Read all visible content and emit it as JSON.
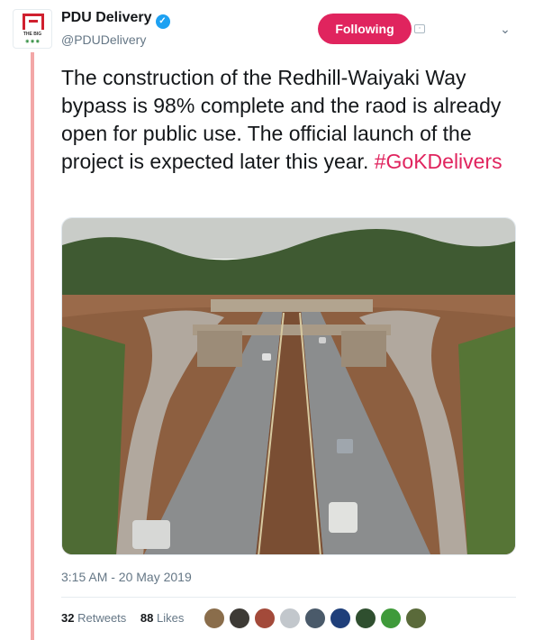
{
  "author": {
    "name": "PDU Delivery",
    "handle": "@PDUDelivery",
    "avatar_text": "THE BIG",
    "avatar_sub": "◉ ◉ ◉"
  },
  "follow_label": "Following",
  "tweet": {
    "text": "The construction of the Redhill-Waiyaki Way bypass is 98% complete and the raod is already open for public use. The official launch of the project is expected later this year.",
    "hashtag": "#GoKDelivers"
  },
  "timestamp": "3:15 AM - 20 May 2019",
  "stats": {
    "retweets_count": "32",
    "retweets_label": "Retweets",
    "likes_count": "88",
    "likes_label": "Likes"
  },
  "likers": [
    {
      "color": "#8a6d4b"
    },
    {
      "color": "#3d3a35"
    },
    {
      "color": "#a34a3a"
    },
    {
      "color": "#c2c7cc"
    },
    {
      "color": "#4a5a6a"
    },
    {
      "color": "#1f3f7a"
    },
    {
      "color": "#2f4f2f"
    },
    {
      "color": "#3f9a3a"
    },
    {
      "color": "#5a6a3a"
    }
  ],
  "colors": {
    "accent": "#e0245e",
    "verified": "#1da1f2",
    "thread": "#f3a7a7"
  }
}
